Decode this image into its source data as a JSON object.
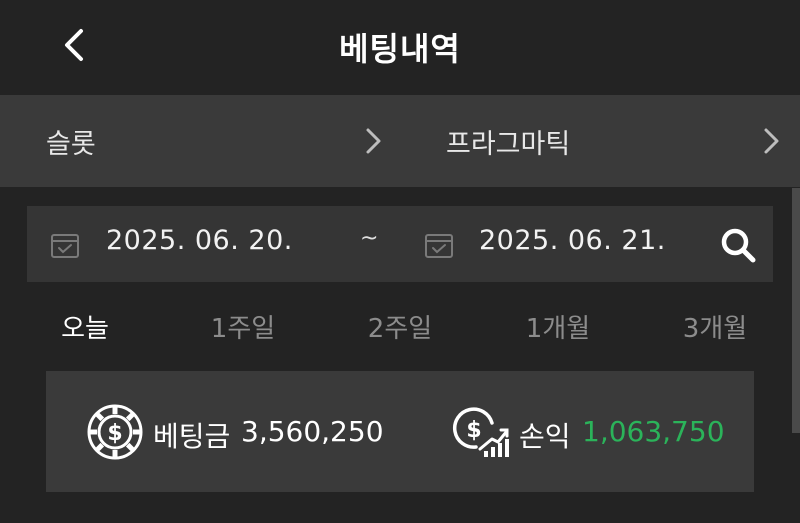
{
  "header": {
    "title": "베팅내역",
    "back_icon": "chevron-left-icon"
  },
  "breadcrumb": {
    "items": [
      {
        "label": "슬롯",
        "icon": "chevron-right-icon"
      },
      {
        "label": "프라그마틱",
        "icon": "chevron-right-icon"
      }
    ]
  },
  "date_range": {
    "start": "2025. 06. 20.",
    "separator": "~",
    "end": "2025. 06. 21.",
    "calendar_icon": "calendar-check-icon",
    "search_icon": "search-icon"
  },
  "periods": [
    {
      "label": "오늘",
      "active": true
    },
    {
      "label": "1주일",
      "active": false
    },
    {
      "label": "2주일",
      "active": false
    },
    {
      "label": "1개월",
      "active": false
    },
    {
      "label": "3개월",
      "active": false
    }
  ],
  "summary": {
    "bet_label": "베팅금",
    "bet_value": "3,560,250",
    "bet_icon": "casino-chip-dollar-icon",
    "profit_label": "손익",
    "profit_value": "1,063,750",
    "profit_icon": "dollar-growth-chart-icon",
    "profit_color": "#2bb35a"
  },
  "colors": {
    "background": "#232323",
    "panel": "#3a3a3a",
    "date_panel": "#353535",
    "inactive_text": "#8c8c8c",
    "profit_positive": "#2bb35a"
  }
}
